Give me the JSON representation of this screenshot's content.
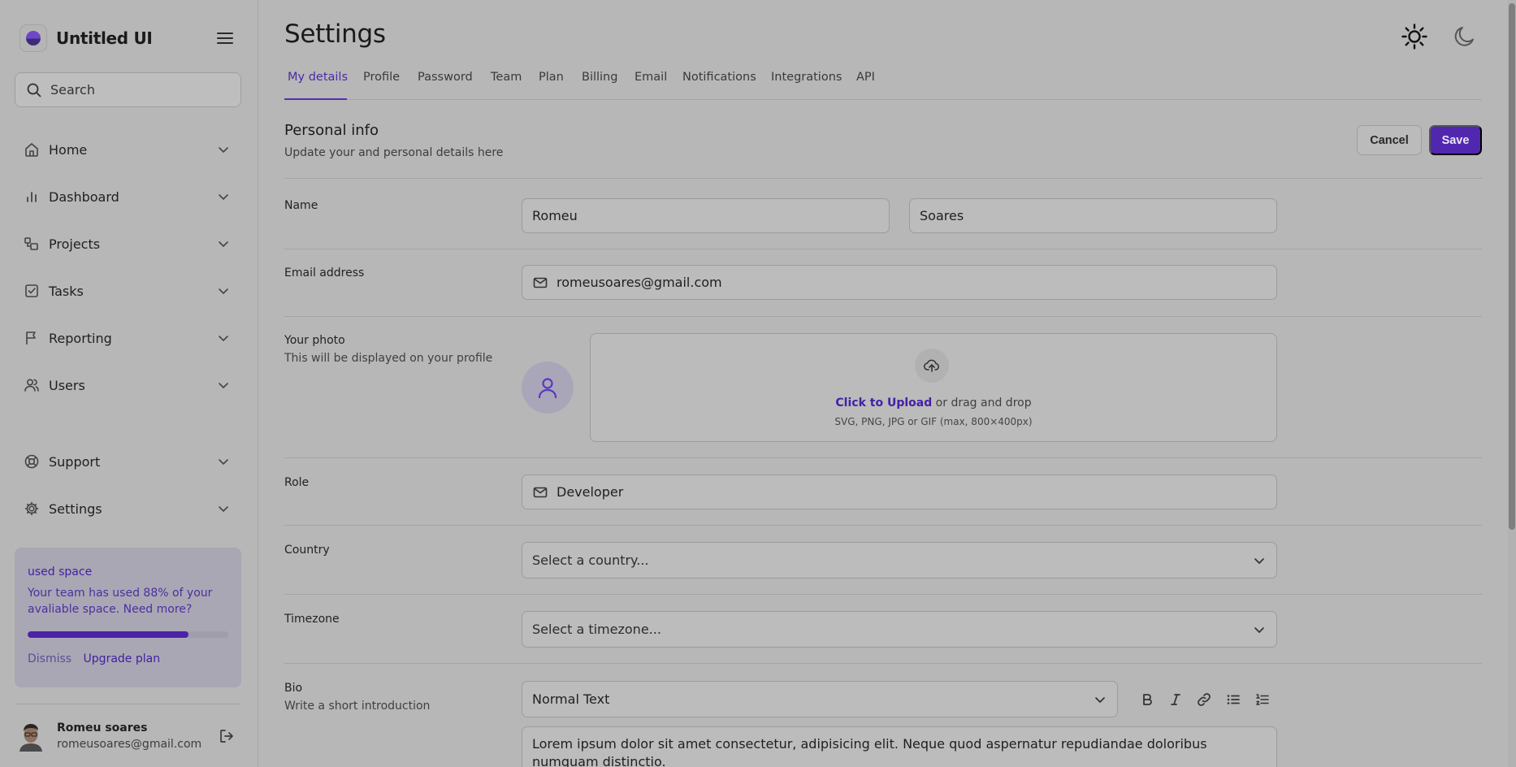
{
  "app": {
    "name": "Untitled UI"
  },
  "sidebar": {
    "search_placeholder": "Search",
    "items": [
      {
        "label": "Home",
        "icon": "home-icon"
      },
      {
        "label": "Dashboard",
        "icon": "bar-chart-icon"
      },
      {
        "label": "Projects",
        "icon": "projects-icon"
      },
      {
        "label": "Tasks",
        "icon": "check-square-icon"
      },
      {
        "label": "Reporting",
        "icon": "flag-icon"
      },
      {
        "label": "Users",
        "icon": "users-icon"
      },
      {
        "label": "Support",
        "icon": "life-buoy-icon"
      },
      {
        "label": "Settings",
        "icon": "gear-icon"
      }
    ],
    "usage_card": {
      "title": "used space",
      "text": "Your team has used 88% of your avaliable space. Need more?",
      "progress": 0.8,
      "dismiss_label": "Dismiss",
      "upgrade_label": "Upgrade plan"
    },
    "user": {
      "name": "Romeu soares",
      "email": "romeusoares@gmail.com"
    }
  },
  "header": {
    "title": "Settings"
  },
  "tabs": [
    {
      "label": "My details",
      "active": true
    },
    {
      "label": "Profile"
    },
    {
      "label": "Password"
    },
    {
      "label": "Team"
    },
    {
      "label": "Plan"
    },
    {
      "label": "Billing"
    },
    {
      "label": "Email"
    },
    {
      "label": "Notifications"
    },
    {
      "label": "Integrations"
    },
    {
      "label": "API"
    }
  ],
  "section": {
    "title": "Personal info",
    "subtitle": "Update your and personal details here",
    "cancel_label": "Cancel",
    "save_label": "Save"
  },
  "form": {
    "name": {
      "label": "Name",
      "first": "Romeu",
      "last": "Soares"
    },
    "email": {
      "label": "Email address",
      "value": "romeusoares@gmail.com"
    },
    "photo": {
      "label": "Your photo",
      "sublabel": "This will be displayed on your profile",
      "upload_link": "Click to Upload",
      "upload_text": " or drag and drop",
      "upload_hint": "SVG, PNG, JPG or GIF (max, 800×400px)"
    },
    "role": {
      "label": "Role",
      "value": "Developer"
    },
    "country": {
      "label": "Country",
      "placeholder": "Select a country..."
    },
    "timezone": {
      "label": "Timezone",
      "placeholder": "Select a timezone..."
    },
    "bio": {
      "label": "Bio",
      "sublabel": "Write a short introduction",
      "format": "Normal Text",
      "text": "Lorem ipsum dolor sit amet consectetur, adipisicing elit. Neque quod aspernatur repudiandae doloribus numquam distinctio."
    }
  },
  "colors": {
    "accent": "#5227b0",
    "background": "#b7b7b7"
  }
}
